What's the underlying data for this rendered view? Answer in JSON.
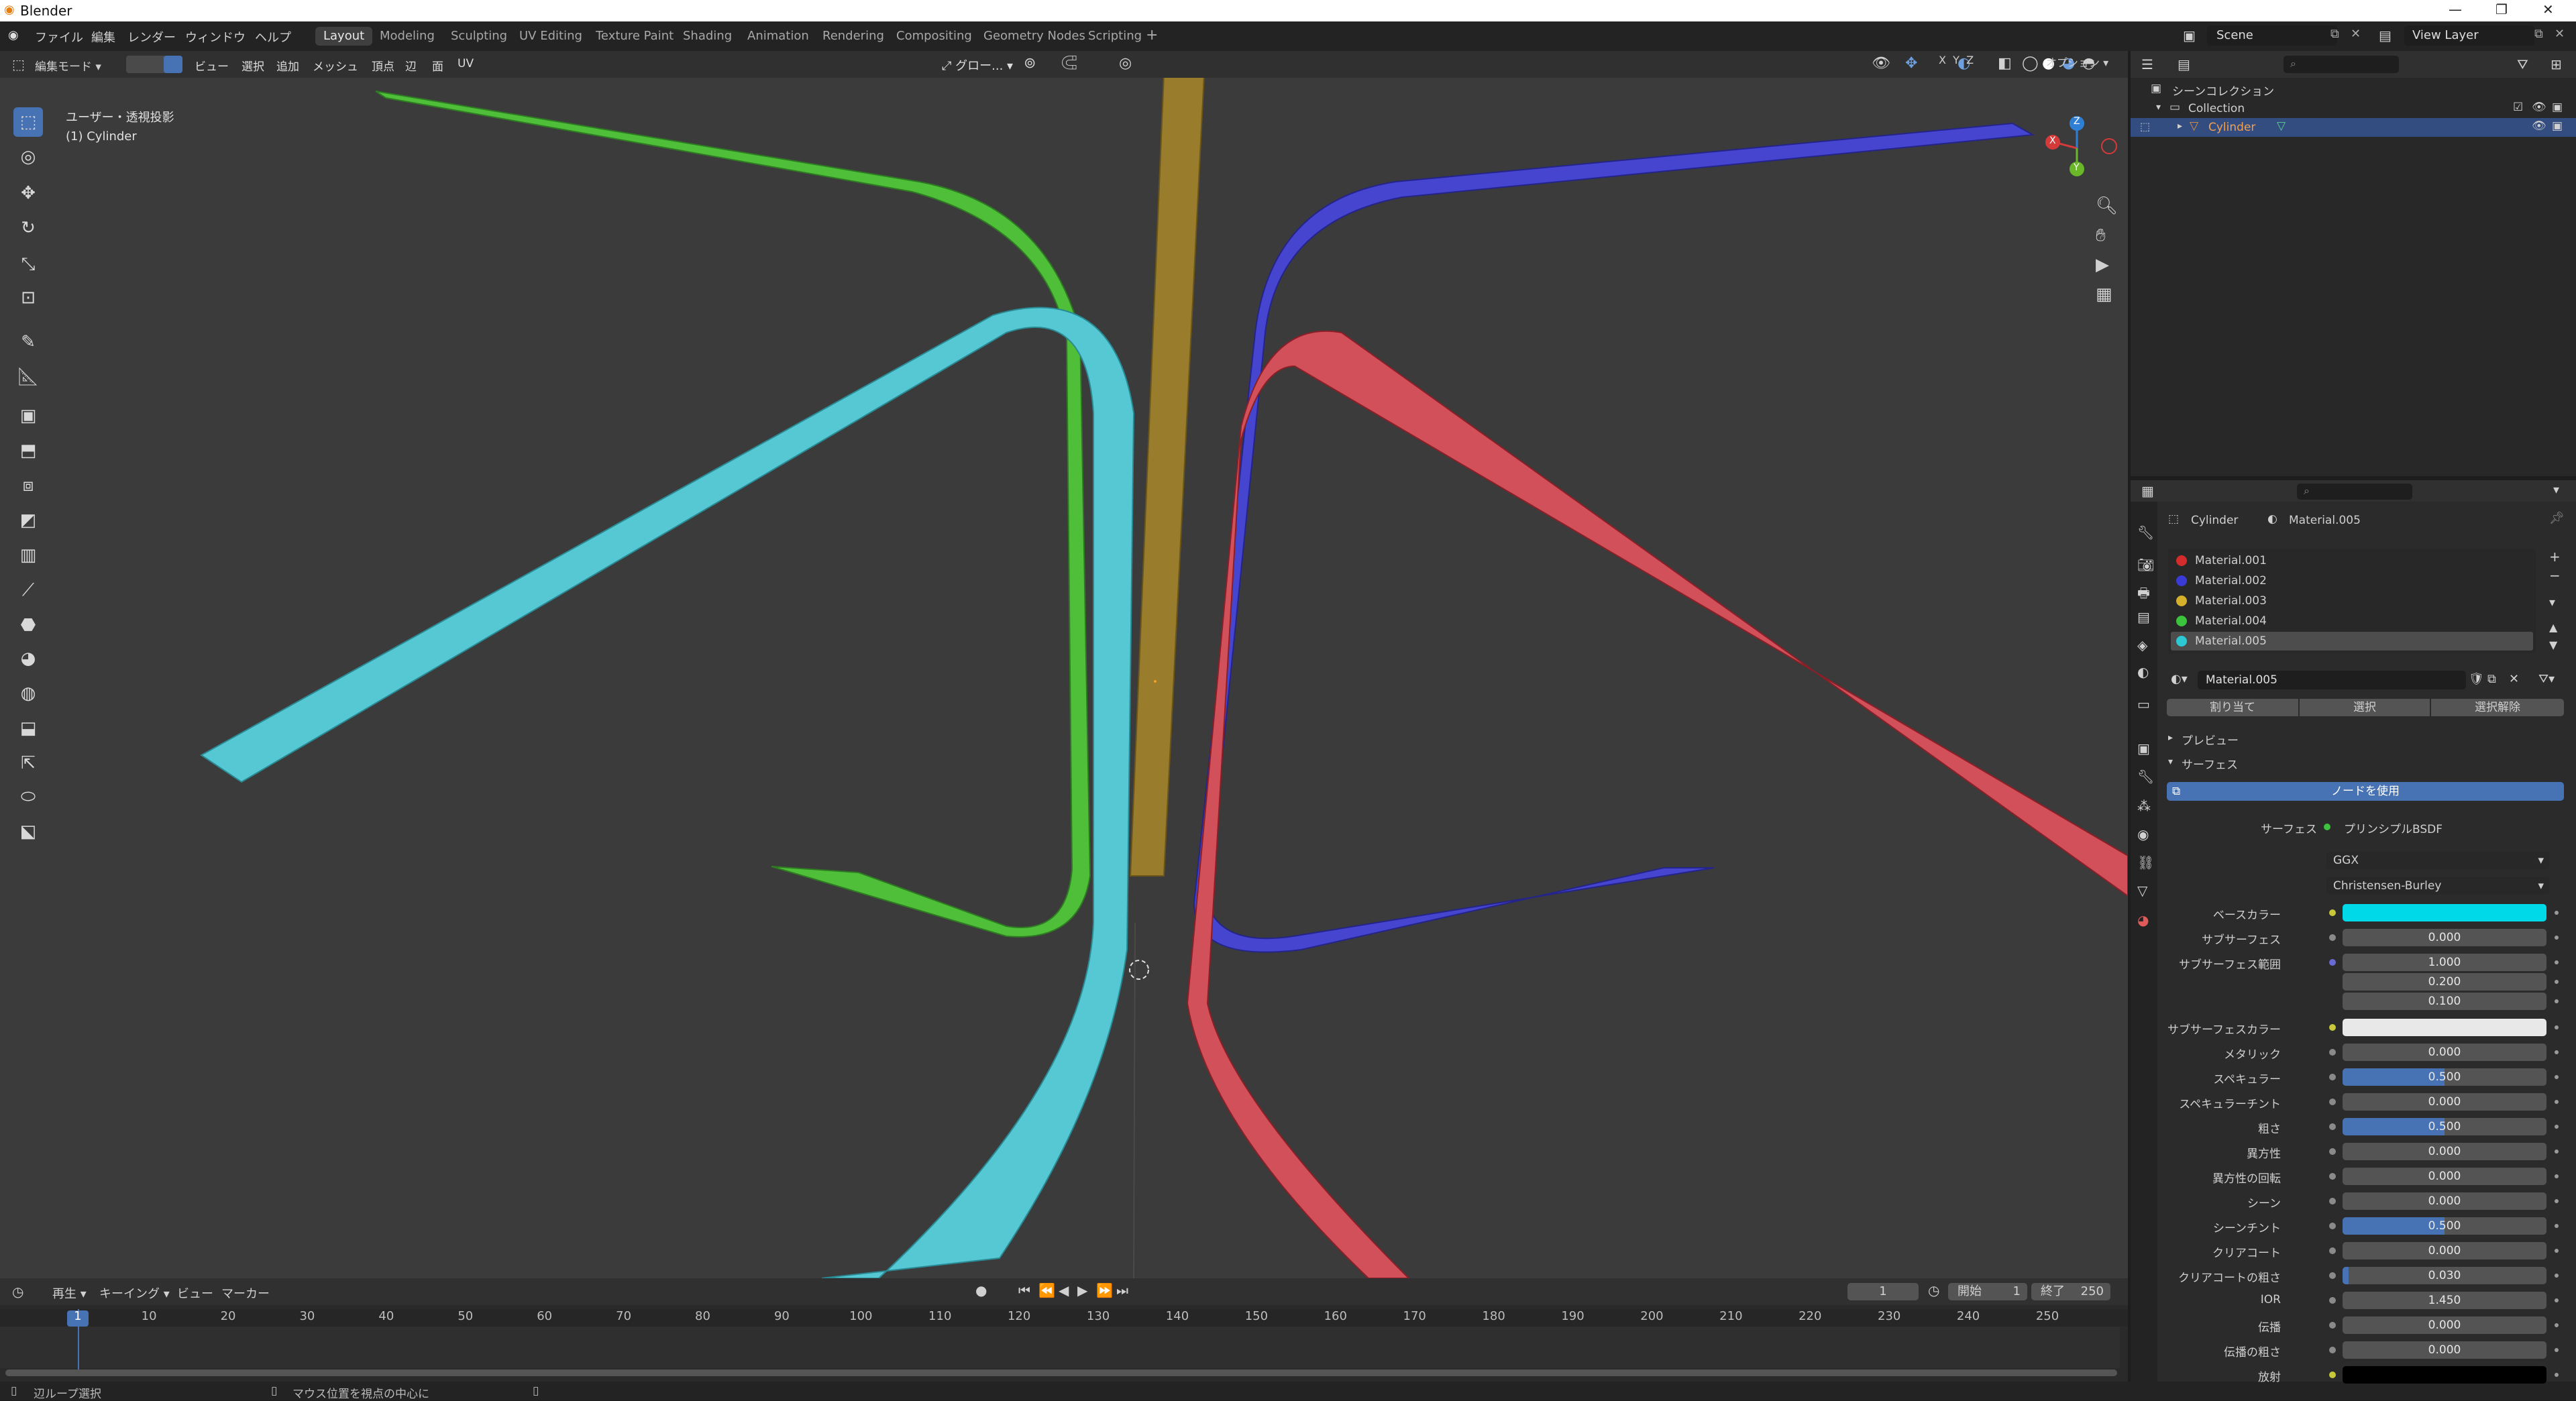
{
  "window": {
    "title": "Blender"
  },
  "menu": {
    "items": [
      "ファイル",
      "編集",
      "レンダー",
      "ウィンドウ",
      "ヘルプ"
    ]
  },
  "workspaces": [
    "Layout",
    "Modeling",
    "Sculpting",
    "UV Editing",
    "Texture Paint",
    "Shading",
    "Animation",
    "Rendering",
    "Compositing",
    "Geometry Nodes",
    "Scripting"
  ],
  "active_workspace": "Layout",
  "scene": {
    "name": "Scene",
    "view_layer": "View Layer"
  },
  "viewport": {
    "mode": "編集モード",
    "menus": [
      "ビュー",
      "選択",
      "追加",
      "メッシュ",
      "頂点",
      "辺",
      "面",
      "UV"
    ],
    "transform_orientation": "グロー...",
    "options_label": "オプション",
    "axes": [
      "X",
      "Y",
      "Z"
    ],
    "view_label": "ユーザー・透視投影",
    "object_label": "(1) Cylinder",
    "gizmo": {
      "x": "X",
      "y": "Y",
      "z": "Z"
    }
  },
  "timeline": {
    "menus": [
      "再生",
      "キーイング",
      "ビュー",
      "マーカー"
    ],
    "current_frame": "1",
    "start_label": "開始",
    "start": "1",
    "end_label": "終了",
    "end": "250",
    "ticks": [
      "1",
      "10",
      "20",
      "30",
      "40",
      "50",
      "60",
      "70",
      "80",
      "90",
      "100",
      "110",
      "120",
      "130",
      "140",
      "150",
      "160",
      "170",
      "180",
      "190",
      "200",
      "210",
      "220",
      "230",
      "240",
      "250"
    ]
  },
  "statusbar": {
    "left": "辺ループ選択",
    "middle": "マウス位置を視点の中心に"
  },
  "outliner": {
    "root": "シーンコレクション",
    "collection": "Collection",
    "object": "Cylinder"
  },
  "properties": {
    "breadcrumb_object": "Cylinder",
    "breadcrumb_material": "Material.005",
    "slots": [
      {
        "name": "Material.001",
        "color": "#d42c2c"
      },
      {
        "name": "Material.002",
        "color": "#3a3ad4"
      },
      {
        "name": "Material.003",
        "color": "#d4b02c"
      },
      {
        "name": "Material.004",
        "color": "#3cc23c"
      },
      {
        "name": "Material.005",
        "color": "#2cc8d4"
      }
    ],
    "active_material": "Material.005",
    "assign_label": "割り当て",
    "select_label": "選択",
    "deselect_label": "選択解除",
    "preview_panel": "プレビュー",
    "surface_panel": "サーフェス",
    "use_nodes": "ノードを使用",
    "surface_label": "サーフェス",
    "surface_shader": "プリンシプルBSDF",
    "distribution": "GGX",
    "subsurface_method": "Christensen-Burley",
    "fields": [
      {
        "label": "ベースカラー",
        "type": "color",
        "color": "#00d9e8",
        "dot": "#c8c83a"
      },
      {
        "label": "サブサーフェス",
        "value": "0.000",
        "dot": "#8a8a8a"
      },
      {
        "label": "サブサーフェス範囲",
        "type": "vector",
        "values": [
          "1.000",
          "0.200",
          "0.100"
        ],
        "dot": "#6a6ad4"
      },
      {
        "label": "サブサーフェスカラー",
        "type": "color",
        "color": "#e8e8e8",
        "dot": "#c8c83a"
      },
      {
        "label": "メタリック",
        "value": "0.000",
        "dot": "#8a8a8a"
      },
      {
        "label": "スペキュラー",
        "value": "0.500",
        "fill": 0.5,
        "dot": "#8a8a8a"
      },
      {
        "label": "スペキュラーチント",
        "value": "0.000",
        "dot": "#8a8a8a"
      },
      {
        "label": "粗さ",
        "value": "0.500",
        "fill": 0.5,
        "dot": "#8a8a8a"
      },
      {
        "label": "異方性",
        "value": "0.000",
        "dot": "#8a8a8a"
      },
      {
        "label": "異方性の回転",
        "value": "0.000",
        "dot": "#8a8a8a"
      },
      {
        "label": "シーン",
        "value": "0.000",
        "dot": "#8a8a8a"
      },
      {
        "label": "シーンチント",
        "value": "0.500",
        "fill": 0.5,
        "dot": "#8a8a8a"
      },
      {
        "label": "クリアコート",
        "value": "0.000",
        "dot": "#8a8a8a"
      },
      {
        "label": "クリアコートの粗さ",
        "value": "0.030",
        "fill": 0.03,
        "dot": "#8a8a8a"
      },
      {
        "label": "IOR",
        "value": "1.450",
        "dot": "#8a8a8a"
      },
      {
        "label": "伝播",
        "value": "0.000",
        "dot": "#8a8a8a"
      },
      {
        "label": "伝播の粗さ",
        "value": "0.000",
        "dot": "#8a8a8a"
      },
      {
        "label": "放射",
        "type": "color",
        "color": "#000000",
        "dot": "#c8c83a"
      }
    ]
  },
  "colors": {
    "accent": "#4772b3",
    "viewport_bg": "#3b3b3b",
    "selection": "#334d80"
  }
}
